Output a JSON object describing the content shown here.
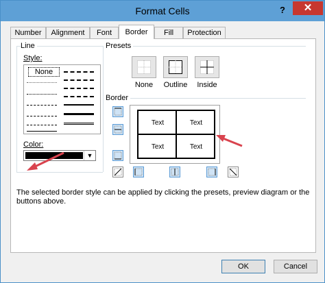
{
  "window": {
    "title": "Format Cells",
    "help": "?",
    "close": "✕"
  },
  "tabs": [
    "Number",
    "Alignment",
    "Font",
    "Border",
    "Fill",
    "Protection"
  ],
  "active_tab": "Border",
  "line": {
    "group_label": "Line",
    "style_label": "Style:",
    "none_label": "None",
    "color_label": "Color:",
    "color_value": "#000000"
  },
  "presets": {
    "group_label": "Presets",
    "items": [
      "None",
      "Outline",
      "Inside"
    ]
  },
  "border": {
    "group_label": "Border",
    "preview_cells": [
      "Text",
      "Text",
      "Text",
      "Text"
    ]
  },
  "info": "The selected border style can be applied by clicking the presets, preview diagram or the buttons above.",
  "buttons": {
    "ok": "OK",
    "cancel": "Cancel"
  },
  "colors": {
    "accent": "#5ea0d6",
    "close": "#c7372f",
    "arrow": "#d9434e",
    "selected_button": "#cfe3f5"
  }
}
